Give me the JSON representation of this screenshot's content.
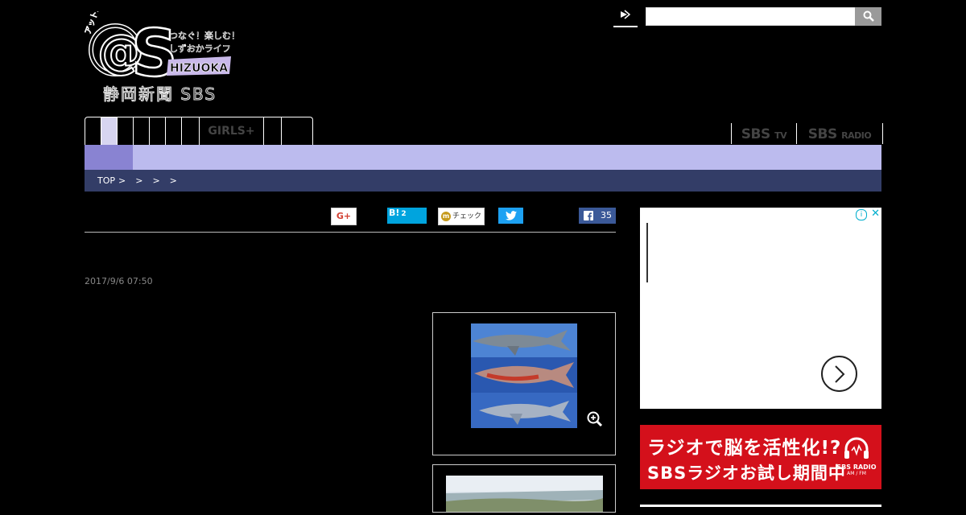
{
  "logo": {
    "ruby": "アットエス",
    "mark": "@S",
    "tagline1": "つなぐ！楽しむ！",
    "tagline2": "しずおかライフ",
    "region": "HIZUOKA",
    "company": "静岡新聞 SBS"
  },
  "search": {
    "value": "",
    "button_icon": "search-icon"
  },
  "nav": {
    "girls_label": "GIRLS+"
  },
  "brands": {
    "tv": "SBS",
    "tv_suffix": "TV",
    "radio": "SBS",
    "radio_suffix": "RADIO"
  },
  "breadcrumb": {
    "top": "TOP",
    "separator": ">"
  },
  "share": {
    "gplus_label": "G+",
    "hatena_label": "B!",
    "hatena_count": "2",
    "mixi_label": "チェック",
    "facebook_count": "35"
  },
  "article": {
    "date": "2017/9/6 07:50"
  },
  "ads": {
    "radio_line1": "ラジオで脳を活性化!?",
    "radio_line2": "SBSラジオお試し期間中",
    "radio_logo": "SBS RADIO",
    "radio_logo_sub": "AM / FM"
  },
  "colors": {
    "nav_subbar": "#bcbbee",
    "nav_active": "#8983d2",
    "breadcrumb_bg": "#333d67",
    "radio_ad_bg": "#d4101b"
  }
}
